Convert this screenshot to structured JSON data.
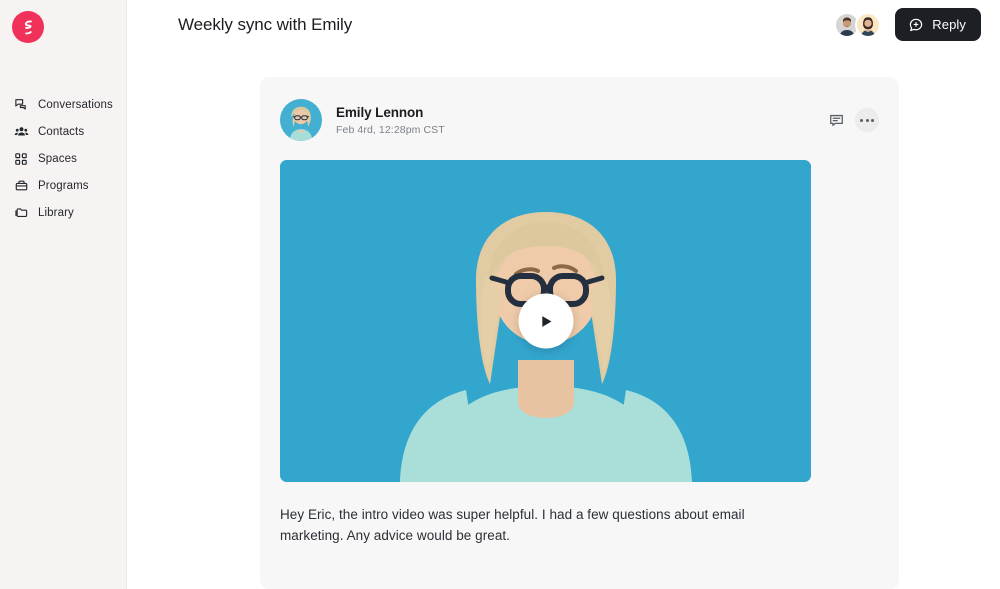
{
  "brand": {
    "logo_icon": "bolt-logo-icon",
    "accent_color": "#f0325a"
  },
  "sidebar": {
    "items": [
      {
        "label": "Conversations",
        "icon": "conversations-icon"
      },
      {
        "label": "Contacts",
        "icon": "contacts-icon"
      },
      {
        "label": "Spaces",
        "icon": "spaces-icon"
      },
      {
        "label": "Programs",
        "icon": "programs-icon"
      },
      {
        "label": "Library",
        "icon": "library-icon"
      }
    ],
    "background_color": "#f8f3f3"
  },
  "header": {
    "title": "Weekly sync with Emily",
    "participants": [
      {
        "name": "participant-1",
        "icon": "avatar-man"
      },
      {
        "name": "participant-2",
        "icon": "avatar-woman"
      }
    ],
    "reply_button": {
      "label": "Reply",
      "icon": "chat-plus-icon",
      "background_color": "#1c1f23"
    }
  },
  "message": {
    "author": "Emily Lennon",
    "timestamp": "Feb 4rd, 12:28pm CST",
    "avatar_icon": "emily-avatar",
    "actions": {
      "comment_icon": "comment-icon",
      "more_icon": "more-options-icon"
    },
    "video": {
      "play_icon": "play-icon",
      "background_color": "#33a6cd",
      "alt": "Video thumbnail of a woman with glasses in a mint sweater"
    },
    "body": "Hey Eric, the intro video was super helpful. I had a few questions about email marketing. Any advice would be great."
  }
}
